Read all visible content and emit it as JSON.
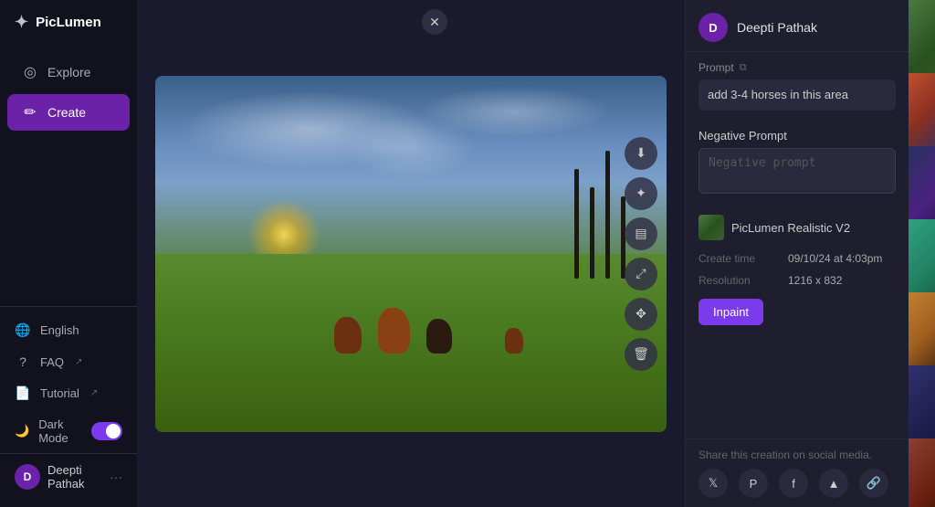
{
  "app": {
    "logo": "✦",
    "name": "PicLumen"
  },
  "sidebar": {
    "explore_label": "Explore",
    "create_label": "Create",
    "english_label": "English",
    "faq_label": "FAQ",
    "tutorial_label": "Tutorial",
    "dark_mode_label": "Dark Mode",
    "user_name": "Deepti Pathak",
    "user_dots": "···"
  },
  "panel": {
    "user_initial": "D",
    "user_name": "Deepti Pathak",
    "prompt_label": "Prompt",
    "prompt_text": "add 3-4 horses in this area",
    "negative_prompt_label": "Negative Prompt",
    "negative_prompt_placeholder": "Negative prompt",
    "model_name": "PicLumen Realistic V2",
    "create_time_label": "Create time",
    "create_time_value": "09/10/24 at 4:03pm",
    "resolution_label": "Resolution",
    "resolution_value": "1216 x 832",
    "inpaint_label": "Inpaint",
    "social_label": "Share this creation on social media."
  },
  "image_actions": {
    "download": "⬇",
    "sparkle": "✦",
    "book": "📋",
    "resize": "⤢",
    "move": "✥",
    "delete": "🗑"
  },
  "close_button": "✕",
  "social_icons": [
    "𝕏",
    "𝐏",
    "f",
    "▲",
    "🔗"
  ]
}
